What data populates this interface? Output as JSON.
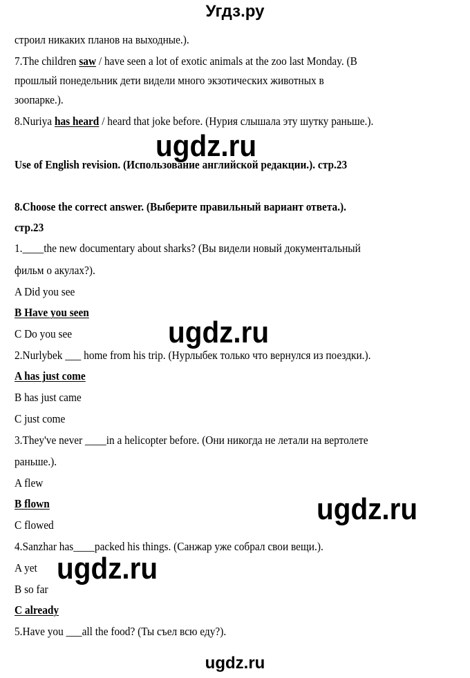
{
  "header": {
    "site_title": "Угдз.ру"
  },
  "continuation": {
    "prev_tail": "строил никаких планов на выходные.).",
    "item7": {
      "number": "7.",
      "pre": "The children ",
      "answer": "saw",
      "post": " / have seen a lot of exotic animals at the zoo last Monday. (В",
      "translation_line2": "прошлый понедельник дети видели много экзотических животных в",
      "translation_line3": "зоопарке.)."
    },
    "item8": {
      "number": "8.",
      "pre": "Nuriya ",
      "answer": "has heard",
      "post": " / heard that joke before. (Нурия слышала эту шутку раньше.)."
    }
  },
  "section": {
    "title": "Use of English revision. (Использование английской редакции.). стр.23"
  },
  "exercise": {
    "title_line1": "8.Choose the correct answer. (Выберите правильный вариант ответа.).",
    "title_line2": "стр.23",
    "questions": [
      {
        "text_line1": "1.____the new documentary about sharks? (Вы видели новый документальный",
        "text_line2": "фильм о акулах?).",
        "options": [
          {
            "label": "A Did you see",
            "correct": false
          },
          {
            "label": "B Have you seen",
            "correct": true
          },
          {
            "label": "C Do you see",
            "correct": false
          }
        ]
      },
      {
        "text_line1": "2.Nurlybek ___ home from his trip. (Нурлыбек только что вернулся из поездки.).",
        "options": [
          {
            "label": "A has just come",
            "correct": true
          },
          {
            "label": "B has just came",
            "correct": false
          },
          {
            "label": "C just come",
            "correct": false
          }
        ]
      },
      {
        "text_line1": "3.They've never ____in a helicopter before. (Они никогда не летали на вертолете",
        "text_line2": "раньше.).",
        "options": [
          {
            "label": "A flew",
            "correct": false
          },
          {
            "label": "B flown",
            "correct": true
          },
          {
            "label": "C flowed",
            "correct": false
          }
        ]
      },
      {
        "text_line1": "4.Sanzhar has____packed his things. (Санжар уже собрал свои вещи.).",
        "options": [
          {
            "label": "A yet",
            "correct": false
          },
          {
            "label": "B so far",
            "correct": false
          },
          {
            "label": "C already",
            "correct": true
          }
        ]
      },
      {
        "text_line1": "5.Have you ___all the food? (Ты съел всю еду?)."
      }
    ]
  },
  "watermarks": [
    "ugdz.ru",
    "ugdz.ru",
    "ugdz.ru",
    "ugdz.ru"
  ],
  "footer": {
    "site_name": "ugdz.ru"
  }
}
